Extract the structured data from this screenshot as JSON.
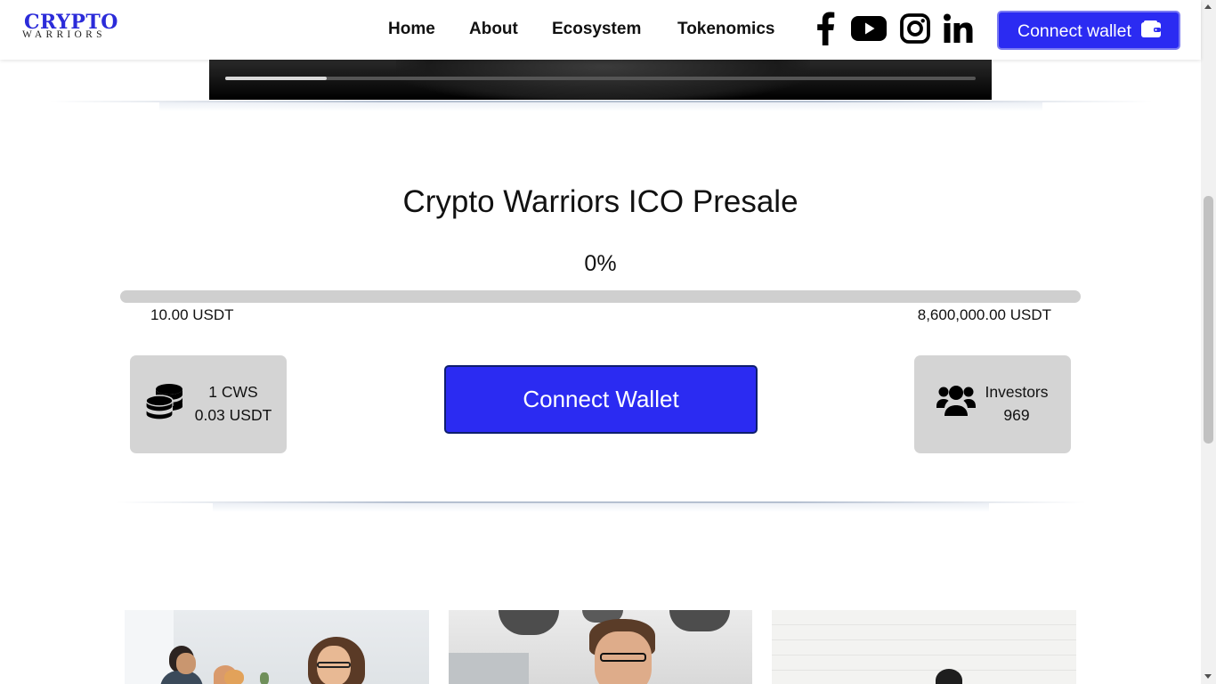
{
  "header": {
    "logo_main": "CRYPTO",
    "logo_sub": "WARRIORS",
    "nav": [
      "Home",
      "About",
      "Ecosystem",
      "Tokenomics"
    ],
    "social_icons": [
      "facebook-icon",
      "youtube-icon",
      "instagram-icon",
      "linkedin-icon"
    ],
    "connect_label": "Connect wallet"
  },
  "video": {
    "progress": 0.135
  },
  "presale": {
    "title": "Crypto Warriors ICO Presale",
    "percent_label": "0%",
    "progress": 0,
    "min_label": "10.00 USDT",
    "max_label": "8,600,000.00 USDT",
    "price_line1": "1 CWS",
    "price_line2": "0.03 USDT",
    "connect_label": "Connect Wallet",
    "investors_label": "Investors",
    "investors_count": "969"
  },
  "colors": {
    "accent": "#2b2bf2",
    "logo": "#2b2bd9",
    "stat_box": "#d4d4d4",
    "progress_track": "#cfcfcf"
  }
}
